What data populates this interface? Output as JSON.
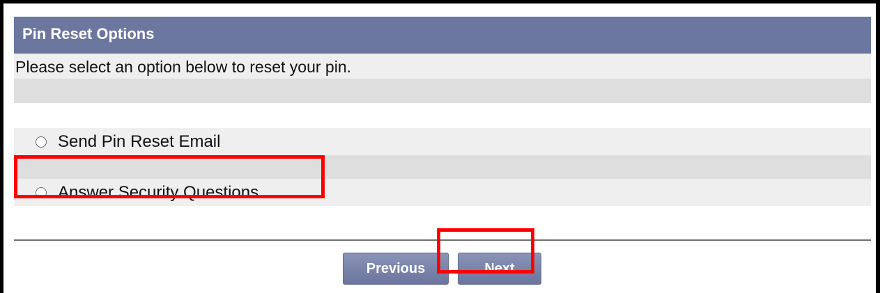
{
  "panel": {
    "title": "Pin Reset Options",
    "instruction": "Please select an option below to reset your pin."
  },
  "options": [
    {
      "label": "Send Pin Reset Email",
      "selected": false
    },
    {
      "label": "Answer Security Questions",
      "selected": false
    }
  ],
  "buttons": {
    "previous_label": "Previous",
    "next_label": "Next"
  },
  "colors": {
    "header_bg": "#6b779f",
    "row_light": "#efefef",
    "row_mid": "#dedede",
    "highlight": "#ff0000"
  }
}
